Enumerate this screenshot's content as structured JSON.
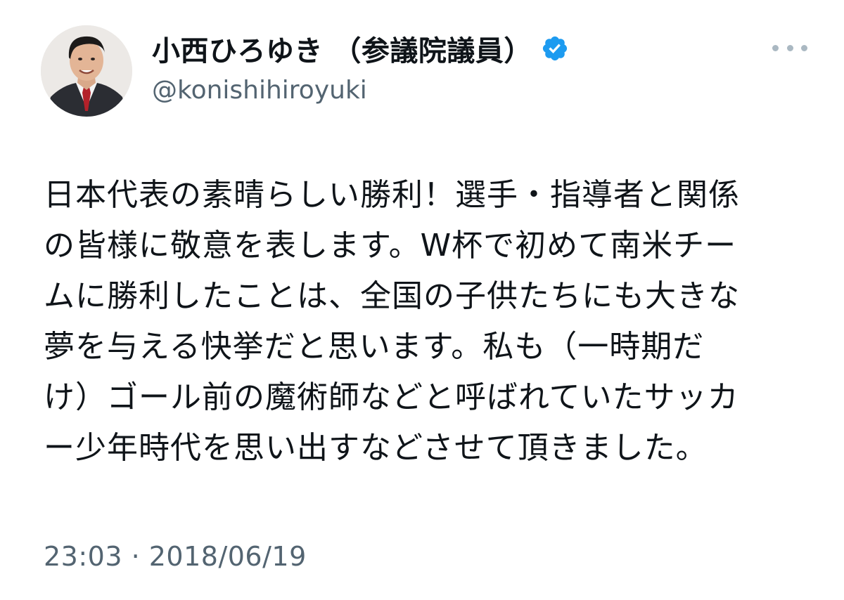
{
  "user": {
    "display_name": "小西ひろゆき （参議院議員）",
    "handle": "@konishihiroyuki",
    "verified": true
  },
  "tweet": {
    "lines": [
      "日本代表の素晴らしい勝利！選手・指導者と関係",
      "の皆様に敬意を表します。W杯で初めて南米チー",
      "ムに勝利したことは、全国の子供たちにも大きな",
      "夢を与える快挙だと思います。私も（一時期だ",
      "け）ゴール前の魔術師などと呼ばれていたサッカ",
      "ー少年時代を思い出すなどさせて頂きました。"
    ],
    "timestamp": "23:03 · 2018/06/19"
  },
  "icons": {
    "verified": "verified-badge-icon",
    "more": "more-options-icon"
  },
  "colors": {
    "verified_blue": "#1d9bf0",
    "secondary_text": "#536471",
    "primary_text": "#0f1419"
  }
}
